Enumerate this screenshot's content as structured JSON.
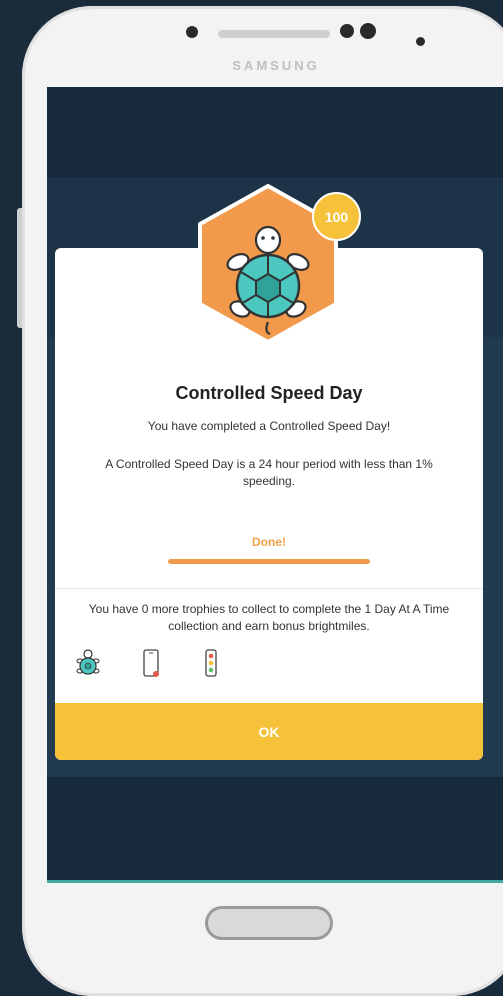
{
  "device": {
    "brand": "SAMSUNG"
  },
  "dialog": {
    "badge_points": "100",
    "badge_icon": "turtle-icon",
    "title": "Controlled Speed Day",
    "subtitle": "You have completed a Controlled Speed Day!",
    "description": "A Controlled Speed Day is a 24 hour period with less than 1% speeding.",
    "done_label": "Done!",
    "collection_text": "You have 0 more trophies to collect to complete the 1 Day At A Time collection and earn bonus brightmiles.",
    "trophies": [
      "turtle-icon",
      "phone-icon",
      "traffic-light-icon"
    ],
    "ok_label": "OK"
  },
  "colors": {
    "accent_orange": "#f19a4b",
    "accent_yellow": "#f6c23a",
    "turtle_teal": "#4cc8c0",
    "background": "#1a2b3b"
  }
}
